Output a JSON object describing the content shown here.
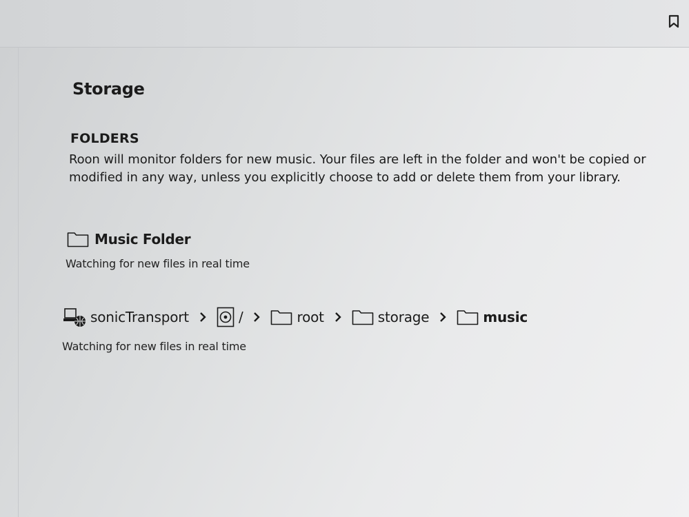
{
  "header": {
    "bookmark_icon": "bookmark-icon"
  },
  "panel": {
    "title": "Storage",
    "section": {
      "title": "FOLDERS",
      "description": "Roon will monitor folders for new music. Your files are left in the folder and won't be copied or modified in any way, unless you explicitly choose to add or delete them from your library."
    },
    "folder": {
      "icon": "folder-icon",
      "name": "Music Folder",
      "status": "Watching for new files in real time"
    },
    "path": {
      "crumbs": [
        {
          "label": "sonicTransport",
          "icon": "network-device-icon"
        },
        {
          "label": "/",
          "icon": "drive-icon"
        },
        {
          "label": "root",
          "icon": "folder-icon"
        },
        {
          "label": "storage",
          "icon": "folder-icon"
        },
        {
          "label": "music",
          "icon": "folder-icon"
        }
      ],
      "status": "Watching for new files in real time"
    }
  }
}
